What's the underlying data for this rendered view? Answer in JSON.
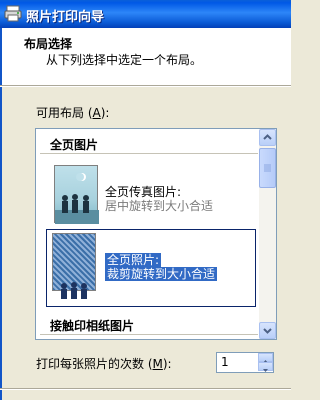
{
  "window": {
    "title": "照片打印向导"
  },
  "header": {
    "title": "布局选择",
    "subtitle": "从下列选择中选定一个布局。"
  },
  "layouts": {
    "label_prefix": "可用布局 (",
    "label_key": "A",
    "label_suffix": "):",
    "groups": [
      {
        "title": "全页图片"
      },
      {
        "title": "接触印相纸图片"
      }
    ],
    "items": [
      {
        "name": "全页传真图片:",
        "desc": "居中旋转到大小合适",
        "selected": false
      },
      {
        "name": "全页照片:",
        "desc": "裁剪旋转到大小合适",
        "selected": true
      }
    ]
  },
  "copies": {
    "label_prefix": "打印每张照片的次数 (",
    "label_key": "M",
    "label_suffix": "):",
    "value": "1"
  },
  "colors": {
    "selection": "#316ac5",
    "titlebar": "#0058e6"
  }
}
